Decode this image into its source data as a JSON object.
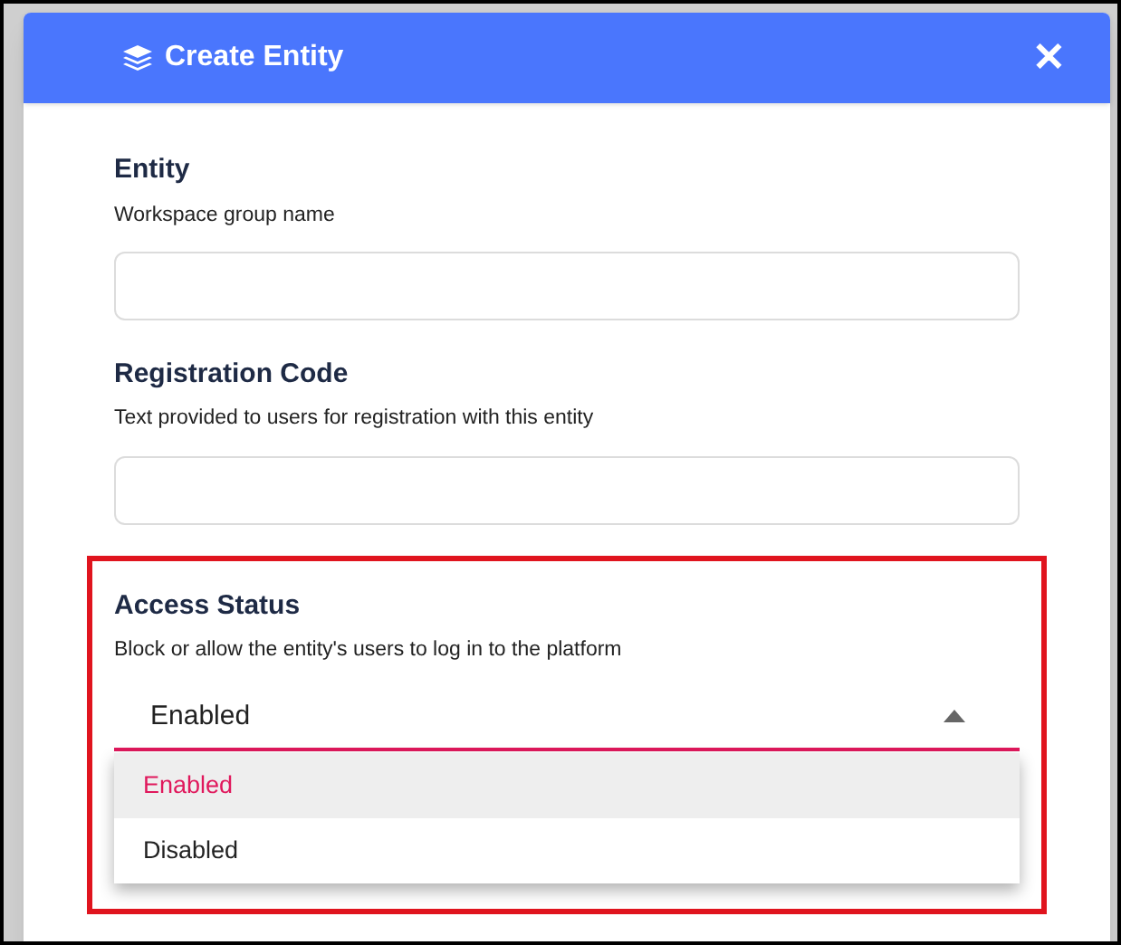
{
  "dialog": {
    "title": "Create Entity",
    "close": "✕"
  },
  "fields": [
    {
      "kind": "text",
      "label": "Entity",
      "hint": "Workspace group name"
    },
    {
      "kind": "text",
      "label": "Registration Code",
      "hint": "Text provided to users for registration with this entity"
    },
    {
      "kind": "select",
      "label": "Access Status",
      "hint": "Block or allow the entity's users to log in to the platform",
      "value": "Enabled",
      "expanded": true,
      "highlighted": true,
      "options": [
        {
          "label": "Enabled",
          "selected": true
        },
        {
          "label": "Disabled",
          "selected": false
        }
      ]
    }
  ]
}
